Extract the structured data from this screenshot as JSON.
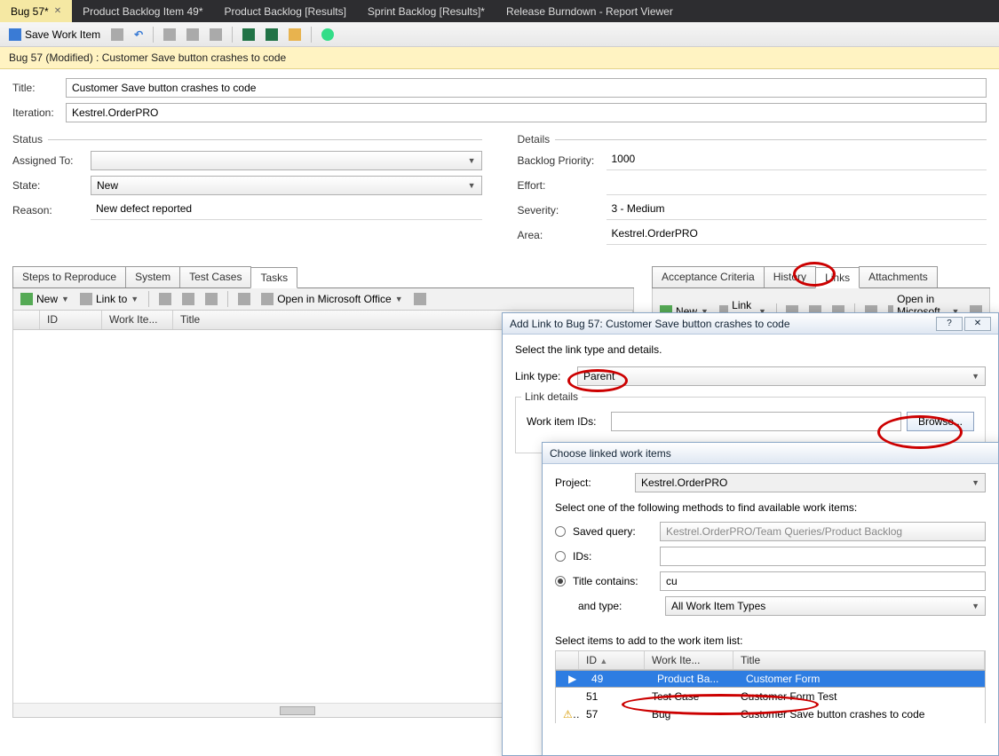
{
  "tabs": [
    {
      "label": "Bug 57*",
      "active": true
    },
    {
      "label": "Product Backlog Item 49*"
    },
    {
      "label": "Product Backlog [Results]"
    },
    {
      "label": "Sprint Backlog [Results]*"
    },
    {
      "label": "Release Burndown - Report Viewer"
    }
  ],
  "toolbar": {
    "save_label": "Save Work Item",
    "open_office": "Open in Microsoft Office"
  },
  "banner": "Bug 57 (Modified) : Customer Save button crashes to code",
  "form": {
    "title_label": "Title:",
    "title": "Customer Save button crashes to code",
    "iteration_label": "Iteration:",
    "iteration": "Kestrel.OrderPRO",
    "status_label": "Status",
    "assigned_label": "Assigned To:",
    "assigned": "",
    "state_label": "State:",
    "state": "New",
    "reason_label": "Reason:",
    "reason": "New defect reported",
    "details_label": "Details",
    "priority_label": "Backlog Priority:",
    "priority": "1000",
    "effort_label": "Effort:",
    "effort": "",
    "severity_label": "Severity:",
    "severity": "3 - Medium",
    "area_label": "Area:",
    "area": "Kestrel.OrderPRO"
  },
  "left_tabs": [
    "Steps to Reproduce",
    "System",
    "Test Cases",
    "Tasks"
  ],
  "left_tabs_active": 3,
  "right_tabs": [
    "Acceptance Criteria",
    "History",
    "Links",
    "Attachments"
  ],
  "right_tabs_active": 2,
  "subtb": {
    "new": "New",
    "linkto": "Link to"
  },
  "grid_cols": [
    "ID",
    "Work Ite...",
    "Title"
  ],
  "add_link_dialog": {
    "title": "Add Link to Bug 57: Customer Save button crashes to code",
    "instr": "Select the link type and details.",
    "type_label": "Link type:",
    "type_value": "Parent",
    "details_label": "Link details",
    "ids_label": "Work item IDs:",
    "ids": "",
    "browse": "Browse..."
  },
  "choose_dialog": {
    "title": "Choose linked work items",
    "project_label": "Project:",
    "project": "Kestrel.OrderPRO",
    "methods_label": "Select one of the following methods to find available work items:",
    "saved_label": "Saved query:",
    "saved_value": "Kestrel.OrderPRO/Team Queries/Product Backlog",
    "ids_label": "IDs:",
    "title_label": "Title contains:",
    "title_value": "cu",
    "type_label": "and type:",
    "type_value": "All Work Item Types",
    "list_label": "Select items to add to the work item list:",
    "cols": [
      "ID",
      "Work Ite...",
      "Title"
    ],
    "rows": [
      {
        "id": "49",
        "type": "Product Ba...",
        "title": "Customer Form",
        "selected": true
      },
      {
        "id": "51",
        "type": "Test Case",
        "title": "Customer Form Test"
      },
      {
        "id": "57",
        "type": "Bug",
        "title": "Customer Save button crashes to code",
        "warn": true
      }
    ]
  }
}
